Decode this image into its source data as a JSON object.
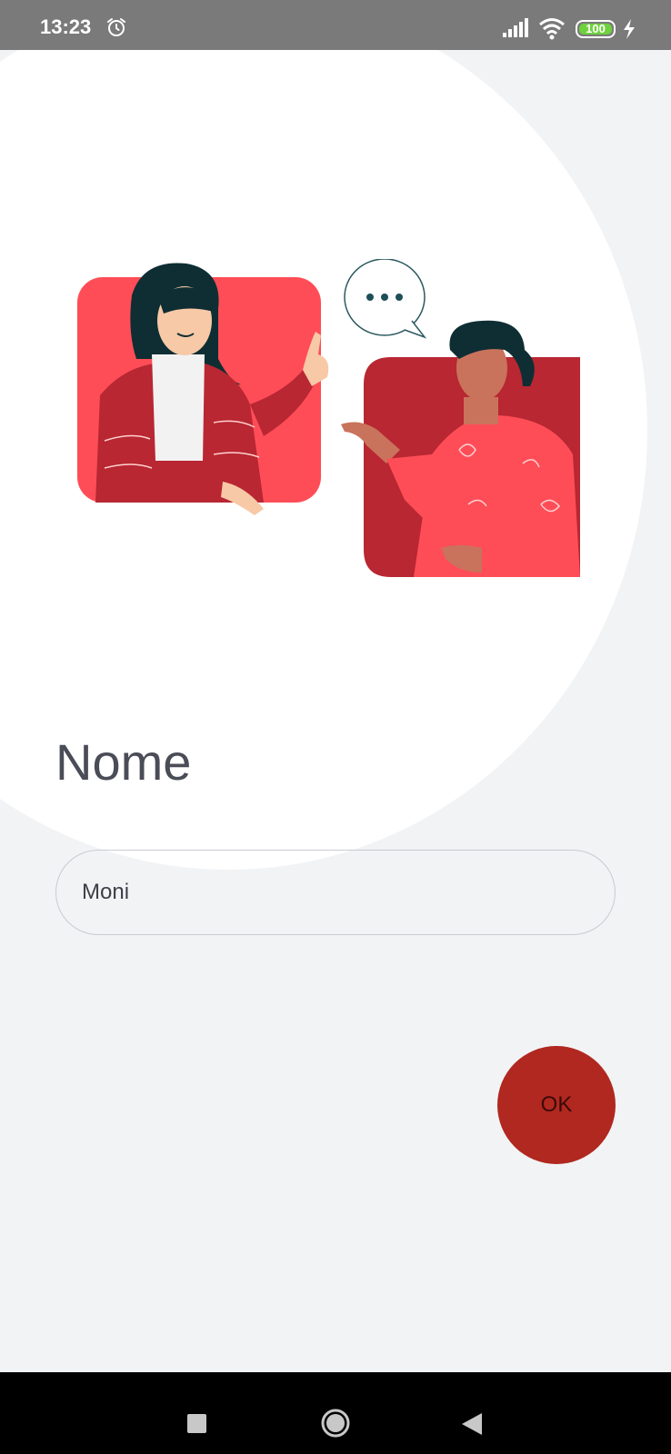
{
  "status_bar": {
    "time": "13:23",
    "battery_level": "100",
    "icons": [
      "alarm-icon",
      "signal-icon",
      "wifi-icon",
      "battery-icon",
      "charging-icon"
    ]
  },
  "illustration": {
    "description_icon": "two-people-chat-illustration",
    "speech_bubble_text": "..."
  },
  "form": {
    "title": "Nome",
    "name_value": "Moni",
    "ok_label": "OK"
  },
  "nav_bar": {
    "items": [
      "recent-apps",
      "home",
      "back"
    ]
  },
  "colors": {
    "accent": "#b0281f",
    "status_bar_bg": "#7a7a7a",
    "page_bg": "#f2f3f5",
    "illustration_red_light": "#ff4d57",
    "illustration_red_dark": "#b82732"
  }
}
